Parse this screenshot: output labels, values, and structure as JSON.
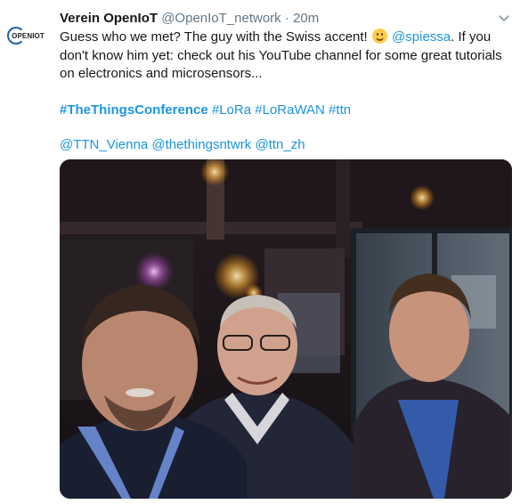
{
  "tweet": {
    "author_name": "Verein OpenIoT",
    "author_handle": "@OpenIoT_network",
    "separator": "·",
    "time": "20m",
    "avatar_text": "OPENIOT",
    "lines": {
      "part1": "Guess who we met? The guy with the Swiss accent!",
      "mention1": "@spiessa",
      "part2": ". If you don't know him yet: check out his YouTube  channel  for some great tutorials on electronics and microsensors..."
    },
    "hashtags": {
      "tag1": "#TheThingsConference",
      "tag2": "#LoRa",
      "tag3": "#LoRaWAN",
      "tag4": "#ttn"
    },
    "mentions": {
      "m1": "@TTN_Vienna",
      "m2": "@thethingsntwrk",
      "m3": "@ttn_zh"
    },
    "icons": {
      "emoji": "smiling-face-emoji",
      "caret": "chevron-down-icon"
    },
    "colors": {
      "link": "#1b95e0",
      "text": "#14171a",
      "muted": "#657786"
    }
  }
}
